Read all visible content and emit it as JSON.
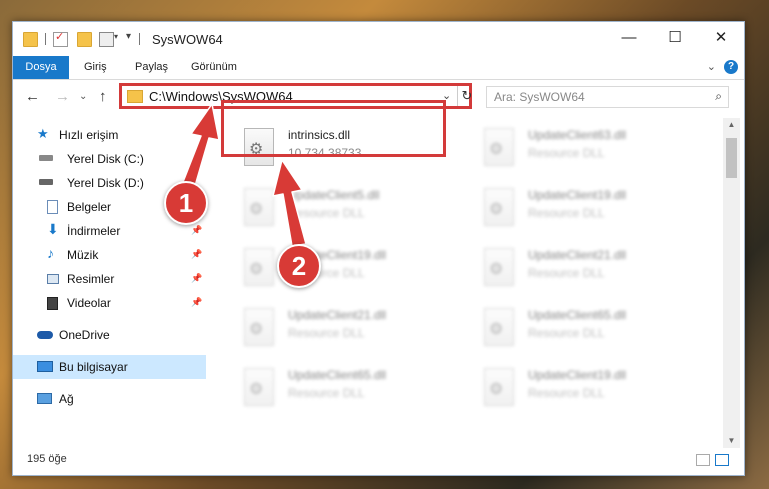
{
  "window": {
    "title": "SysWOW64",
    "controls": {
      "minimize": "—",
      "maximize": "☐",
      "close": "✕"
    }
  },
  "ribbon": {
    "tabs": [
      "Dosya",
      "Giriş",
      "Paylaş",
      "Görünüm"
    ],
    "help": "?"
  },
  "navbar": {
    "address": "C:\\Windows\\SysWOW64",
    "search_placeholder": "Ara: SysWOW64"
  },
  "sidebar": {
    "items": [
      {
        "label": "Hızlı erişim",
        "icon": "star-icon"
      },
      {
        "label": "Yerel Disk (C:)",
        "icon": "drive-icon"
      },
      {
        "label": "Yerel Disk (D:)",
        "icon": "drive-icon"
      },
      {
        "label": "Belgeler",
        "icon": "document-icon",
        "pinned": true
      },
      {
        "label": "İndirmeler",
        "icon": "download-icon",
        "pinned": true
      },
      {
        "label": "Müzik",
        "icon": "music-icon",
        "pinned": true
      },
      {
        "label": "Resimler",
        "icon": "pictures-icon",
        "pinned": true
      },
      {
        "label": "Videolar",
        "icon": "video-icon",
        "pinned": true
      },
      {
        "label": "OneDrive",
        "icon": "cloud-icon"
      },
      {
        "label": "Bu bilgisayar",
        "icon": "computer-icon",
        "selected": true
      },
      {
        "label": "Ağ",
        "icon": "network-icon"
      }
    ]
  },
  "files": [
    {
      "name": "intrinsics.dll",
      "sub": "10.734.38733",
      "highlighted": true
    },
    {
      "name": "UpdateClient63.dll",
      "sub": "Resource DLL"
    },
    {
      "name": "UpdateClient5.dll",
      "sub": "Resource DLL"
    },
    {
      "name": "UpdateClient19.dll",
      "sub": "Resource DLL"
    },
    {
      "name": "UpdateClient19.dll",
      "sub": "Resource DLL"
    },
    {
      "name": "UpdateClient21.dll",
      "sub": "Resource DLL"
    },
    {
      "name": "UpdateClient21.dll",
      "sub": "Resource DLL"
    },
    {
      "name": "UpdateClient65.dll",
      "sub": "Resource DLL"
    },
    {
      "name": "UpdateClient65.dll",
      "sub": "Resource DLL"
    },
    {
      "name": "UpdateClient19.dll",
      "sub": "Resource DLL"
    }
  ],
  "status": {
    "count": "195 öğe"
  },
  "callouts": [
    "1",
    "2"
  ],
  "colors": {
    "accent": "#1979ca",
    "callout": "#d83a36",
    "selection": "#cce8ff"
  }
}
